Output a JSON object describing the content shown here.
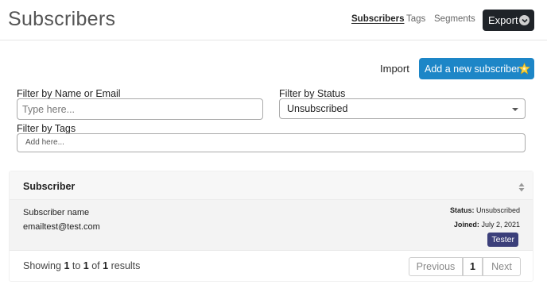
{
  "header": {
    "title": "Subscribers",
    "nav": [
      {
        "label": "Subscribers",
        "active": true
      },
      {
        "label": "Tags",
        "active": false
      },
      {
        "label": "Segments",
        "active": false
      }
    ],
    "export_label": "Export",
    "export_icon": "chevron-down-icon"
  },
  "actions": {
    "import_label": "Import",
    "add_label": "Add a new subscriber",
    "add_icon": "sparkle-star-icon"
  },
  "filters": {
    "name_label": "Filter by Name or Email",
    "name_placeholder": "Type here...",
    "status_label": "Filter by Status",
    "status_value": "Unsubscribed",
    "tags_label": "Filter by Tags",
    "tags_placeholder": "Add here..."
  },
  "table": {
    "column": "Subscriber",
    "rows": [
      {
        "name": "Subscriber name",
        "email": "emailtest@test.com",
        "status_key": "Status:",
        "status": "Unsubscribed",
        "joined_key": "Joined:",
        "joined": "July 2, 2021",
        "tag": "Tester"
      }
    ]
  },
  "pagination": {
    "showing_prefix": "Showing",
    "from": "1",
    "to_word": "to",
    "to": "1",
    "of_word": "of",
    "total": "1",
    "suffix": "results",
    "previous": "Previous",
    "current_page": "1",
    "next": "Next"
  },
  "colors": {
    "primary": "#1d86c7",
    "dark_button": "#1f2328",
    "tag_badge": "#3b3f7a"
  }
}
